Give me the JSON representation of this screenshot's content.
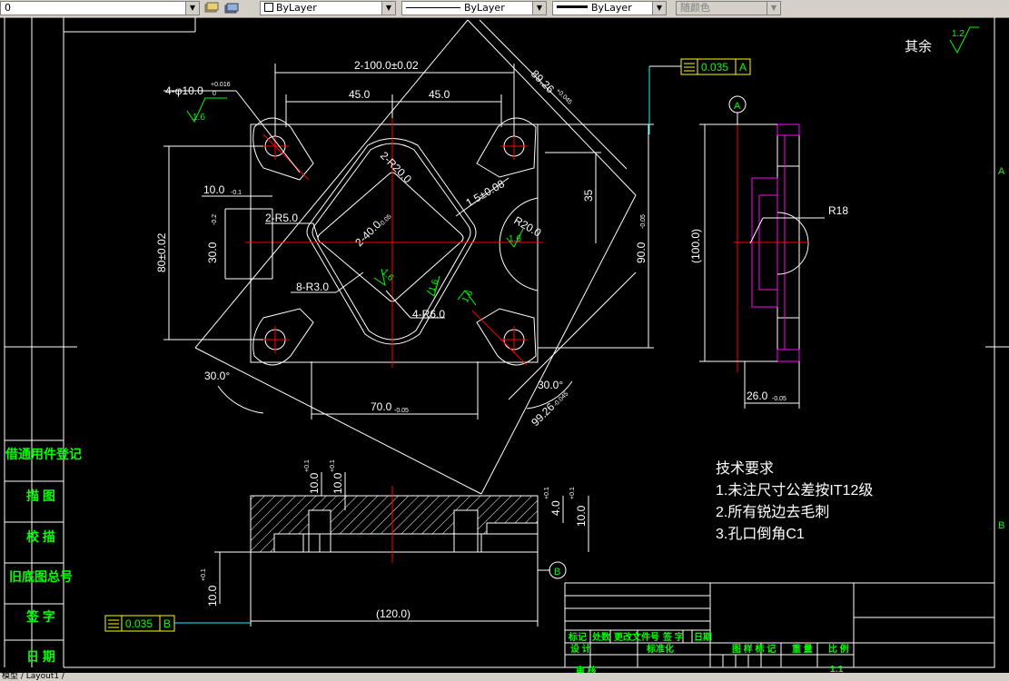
{
  "toolbar": {
    "layer_value": "0",
    "color_value": "ByLayer",
    "linetype_value": "ByLayer",
    "lineweight_value": "ByLayer",
    "plotstyle_value": "随颜色"
  },
  "drawing": {
    "dim_100": "2-100.0±0.02",
    "dim_45_left": "45.0",
    "dim_45_right": "45.0",
    "dim_hole": "4-φ10.0",
    "dim_hole_tol": "+0.016",
    "dim_hole_tol2": "0",
    "rough_16": "1.6",
    "dim_10": "10.0",
    "dim_10_tol": "-0.1",
    "dim_30": "30.0",
    "dim_30_tol": "-0.2",
    "dim_80": "80±0.02",
    "dim_r5": "2-R5.0",
    "dim_r3": "8-R3.0",
    "dim_r6": "4-R6.0",
    "dim_r20": "R20.0",
    "dim_40": "2-40.0",
    "dim_40_tol": "-0.05",
    "dim_2r20": "2-R20.0",
    "dim_15": "1.5±0.08",
    "dim_35": "35",
    "dim_90": "90.0",
    "dim_90_tol": "-0.05",
    "dim_89": "89.26",
    "dim_89_tol": "+0.045",
    "dim_99": "99.26",
    "dim_99_tol": "-0.045",
    "dim_70": "70.0",
    "dim_70_tol": "-0.05",
    "dim_30deg_left": "30.0°",
    "dim_30deg_right": "30.0°",
    "dim_100_side": "(100.0)",
    "dim_r18": "R18",
    "dim_26": "26.0",
    "dim_26_tol": "-0.05",
    "datum_a": "A",
    "datum_b": "B",
    "flat_a_value": "0.035",
    "flat_a_ref": "A",
    "flat_b_value": "0.035",
    "flat_b_ref": "B",
    "rest_label": "其余",
    "rest_rough": "1.2",
    "dim_120": "(120.0)",
    "dim_10_sec_a": "10.0",
    "dim_10_sec_b": "10.0",
    "dim_4": "4.0",
    "dim_10_sec_c": "10.0",
    "dim_10_sec_d": "10.0",
    "sec_tol": "+0.1"
  },
  "tech": {
    "title": "技术要求",
    "line1": "1.未注尺寸公差按IT12级",
    "line2": "2.所有锐边去毛刺",
    "line3": "3.孔口倒角C1"
  },
  "left_column": {
    "item1": "借通用件登记",
    "item2": "描 图",
    "item3": "校 描",
    "item4": "旧底图总号",
    "item5": "签 字",
    "item6": "日 期"
  },
  "title_block": {
    "h1": "标记",
    "h2": "处数",
    "h3": "更改文件号",
    "h4": "签 字",
    "h5": "日期",
    "design": "设 计",
    "standard": "标准化",
    "check": "审 核",
    "stage": "图 样 标 记",
    "weight": "重 量",
    "scale_label": "比 例",
    "scale_value": "1:1"
  },
  "zones": {
    "a": "A",
    "b": "B"
  },
  "status": {
    "text": "模型 / Layout1 /"
  }
}
